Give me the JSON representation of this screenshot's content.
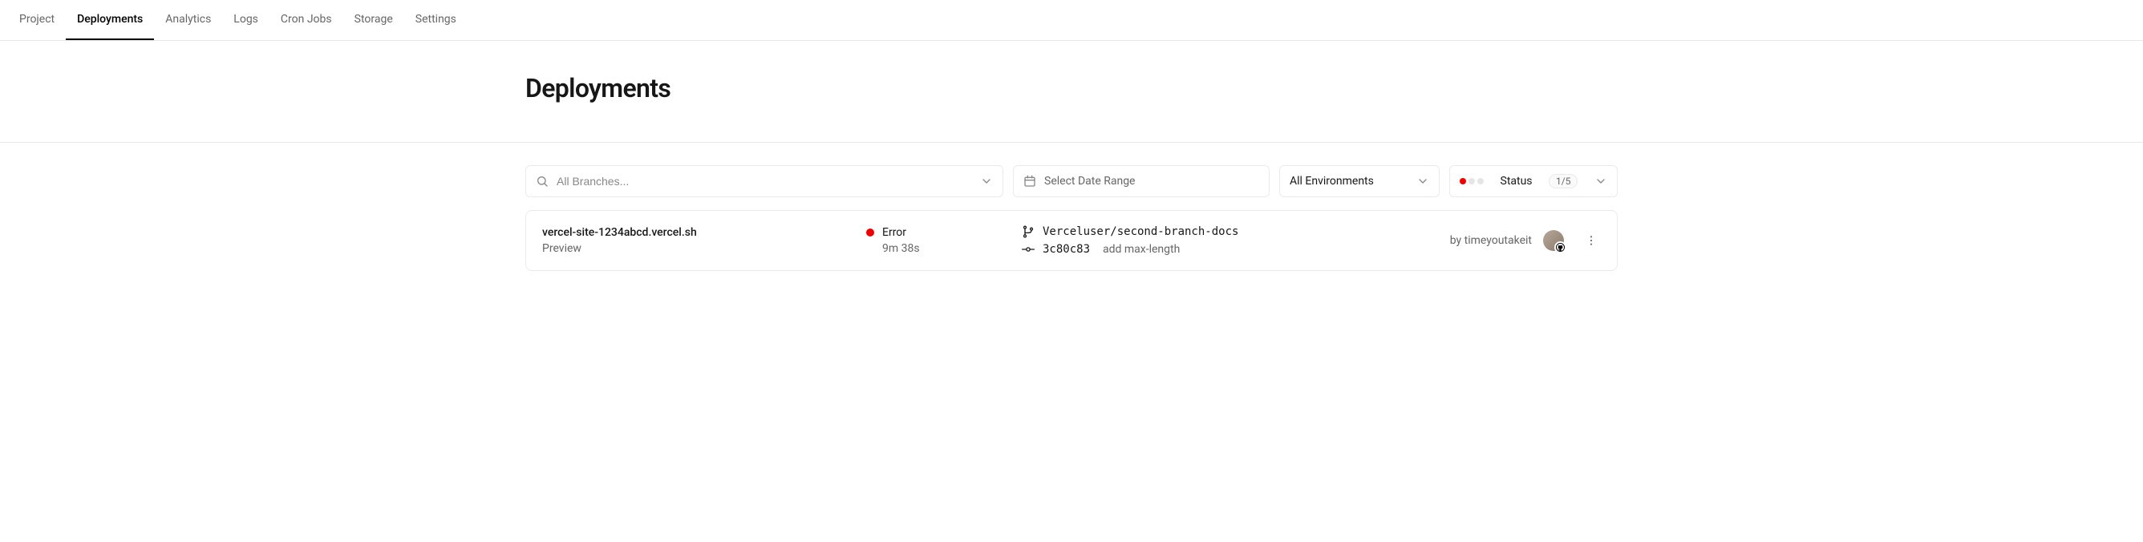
{
  "nav": {
    "tabs": [
      {
        "label": "Project",
        "active": false
      },
      {
        "label": "Deployments",
        "active": true
      },
      {
        "label": "Analytics",
        "active": false
      },
      {
        "label": "Logs",
        "active": false
      },
      {
        "label": "Cron Jobs",
        "active": false
      },
      {
        "label": "Storage",
        "active": false
      },
      {
        "label": "Settings",
        "active": false
      }
    ]
  },
  "header": {
    "title": "Deployments"
  },
  "filters": {
    "branches_placeholder": "All Branches...",
    "date_label": "Select Date Range",
    "env_label": "All Environments",
    "status_label": "Status",
    "status_count": "1/5"
  },
  "deployments": [
    {
      "url": "vercel-site-1234abcd.vercel.sh",
      "environment": "Preview",
      "status": "Error",
      "status_type": "error",
      "duration": "9m 38s",
      "branch": "Verceluser/second-branch-docs",
      "commit_hash": "3c80c83",
      "commit_message": "add max-length",
      "author_prefix": "by ",
      "author": "timeyoutakeit"
    }
  ]
}
